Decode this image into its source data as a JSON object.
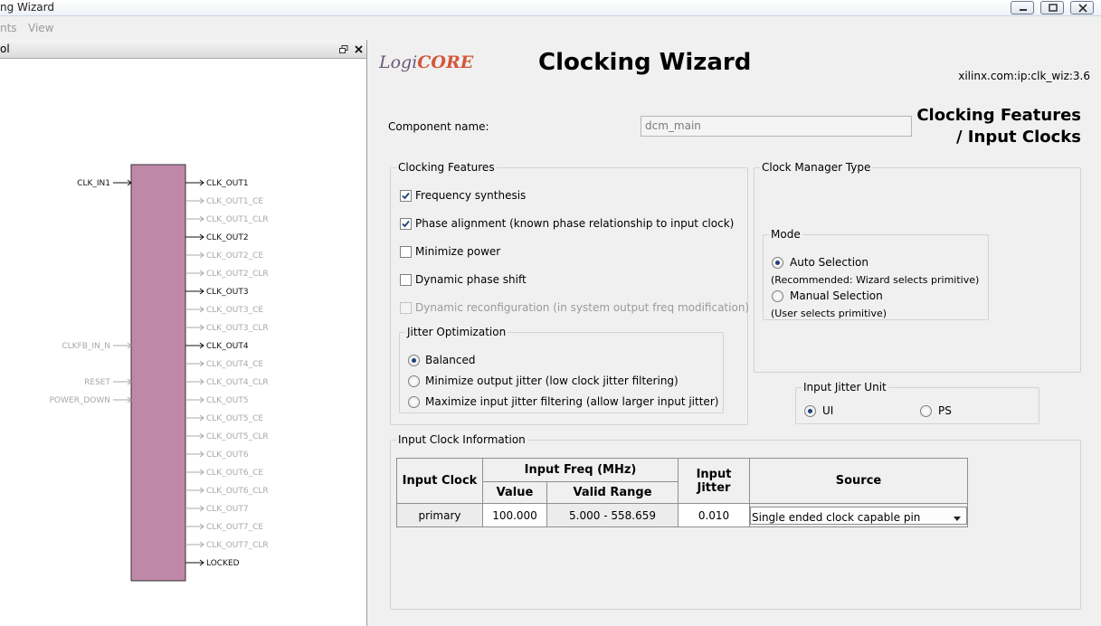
{
  "window": {
    "title": "ng Wizard"
  },
  "menu": {
    "items": [
      "nts",
      "View"
    ]
  },
  "symbol_panel": {
    "title": "ol",
    "inputs": [
      "CLK_IN1",
      "CLKFB_IN_N",
      "RESET",
      "POWER_DOWN"
    ],
    "outputs": [
      "CLK_OUT1",
      "CLK_OUT1_CE",
      "CLK_OUT1_CLR",
      "CLK_OUT2",
      "CLK_OUT2_CE",
      "CLK_OUT2_CLR",
      "CLK_OUT3",
      "CLK_OUT3_CE",
      "CLK_OUT3_CLR",
      "CLK_OUT4",
      "CLK_OUT4_CE",
      "CLK_OUT4_CLR",
      "CLK_OUT5",
      "CLK_OUT5_CE",
      "CLK_OUT5_CLR",
      "CLK_OUT6",
      "CLK_OUT6_CE",
      "CLK_OUT6_CLR",
      "CLK_OUT7",
      "CLK_OUT7_CE",
      "CLK_OUT7_CLR",
      "LOCKED"
    ],
    "active_outputs": [
      "CLK_OUT1",
      "CLK_OUT2",
      "CLK_OUT3",
      "CLK_OUT4",
      "LOCKED"
    ],
    "active_inputs": [
      "CLK_IN1"
    ],
    "block_color": "#c088a8"
  },
  "header": {
    "logo_left": "Logi",
    "logo_right": "CORE",
    "title": "Clocking Wizard",
    "version": "xilinx.com:ip:clk_wiz:3.6",
    "page_heading_line1": "Clocking Features",
    "page_heading_line2": "/ Input Clocks"
  },
  "component": {
    "label": "Component name:",
    "value": "dcm_main"
  },
  "clocking_features": {
    "legend": "Clocking Features",
    "options": [
      {
        "label": "Frequency synthesis",
        "checked": true,
        "enabled": true
      },
      {
        "label": "Phase alignment (known phase relationship to input clock)",
        "checked": true,
        "enabled": true
      },
      {
        "label": "Minimize power",
        "checked": false,
        "enabled": true
      },
      {
        "label": "Dynamic phase shift",
        "checked": false,
        "enabled": true
      },
      {
        "label": "Dynamic reconfiguration (in system output freq modification)",
        "checked": false,
        "enabled": false
      }
    ],
    "jitter": {
      "legend": "Jitter Optimization",
      "options": [
        {
          "label": "Balanced",
          "selected": true
        },
        {
          "label": "Minimize output jitter (low clock jitter filtering)",
          "selected": false
        },
        {
          "label": "Maximize input jitter filtering (allow larger input jitter)",
          "selected": false
        }
      ]
    }
  },
  "clock_manager": {
    "legend": "Clock Manager Type",
    "mode_legend": "Mode",
    "auto_label": "Auto Selection",
    "auto_note": "(Recommended:  Wizard selects primitive)",
    "manual_label": "Manual Selection",
    "manual_note": "(User selects primitive)",
    "selected": "auto"
  },
  "jitter_unit": {
    "legend": "Input Jitter Unit",
    "ui_label": "UI",
    "ps_label": "PS",
    "selected": "UI"
  },
  "input_clock_info": {
    "legend": "Input Clock Information",
    "headers": {
      "input_clock": "Input Clock",
      "input_freq": "Input Freq (MHz)",
      "value": "Value",
      "valid_range": "Valid Range",
      "input_jitter": "Input Jitter",
      "source": "Source"
    },
    "rows": [
      {
        "clock": "primary",
        "value": "100.000",
        "range": "5.000 - 558.659",
        "jitter": "0.010",
        "source": "Single ended clock capable pin"
      }
    ]
  }
}
